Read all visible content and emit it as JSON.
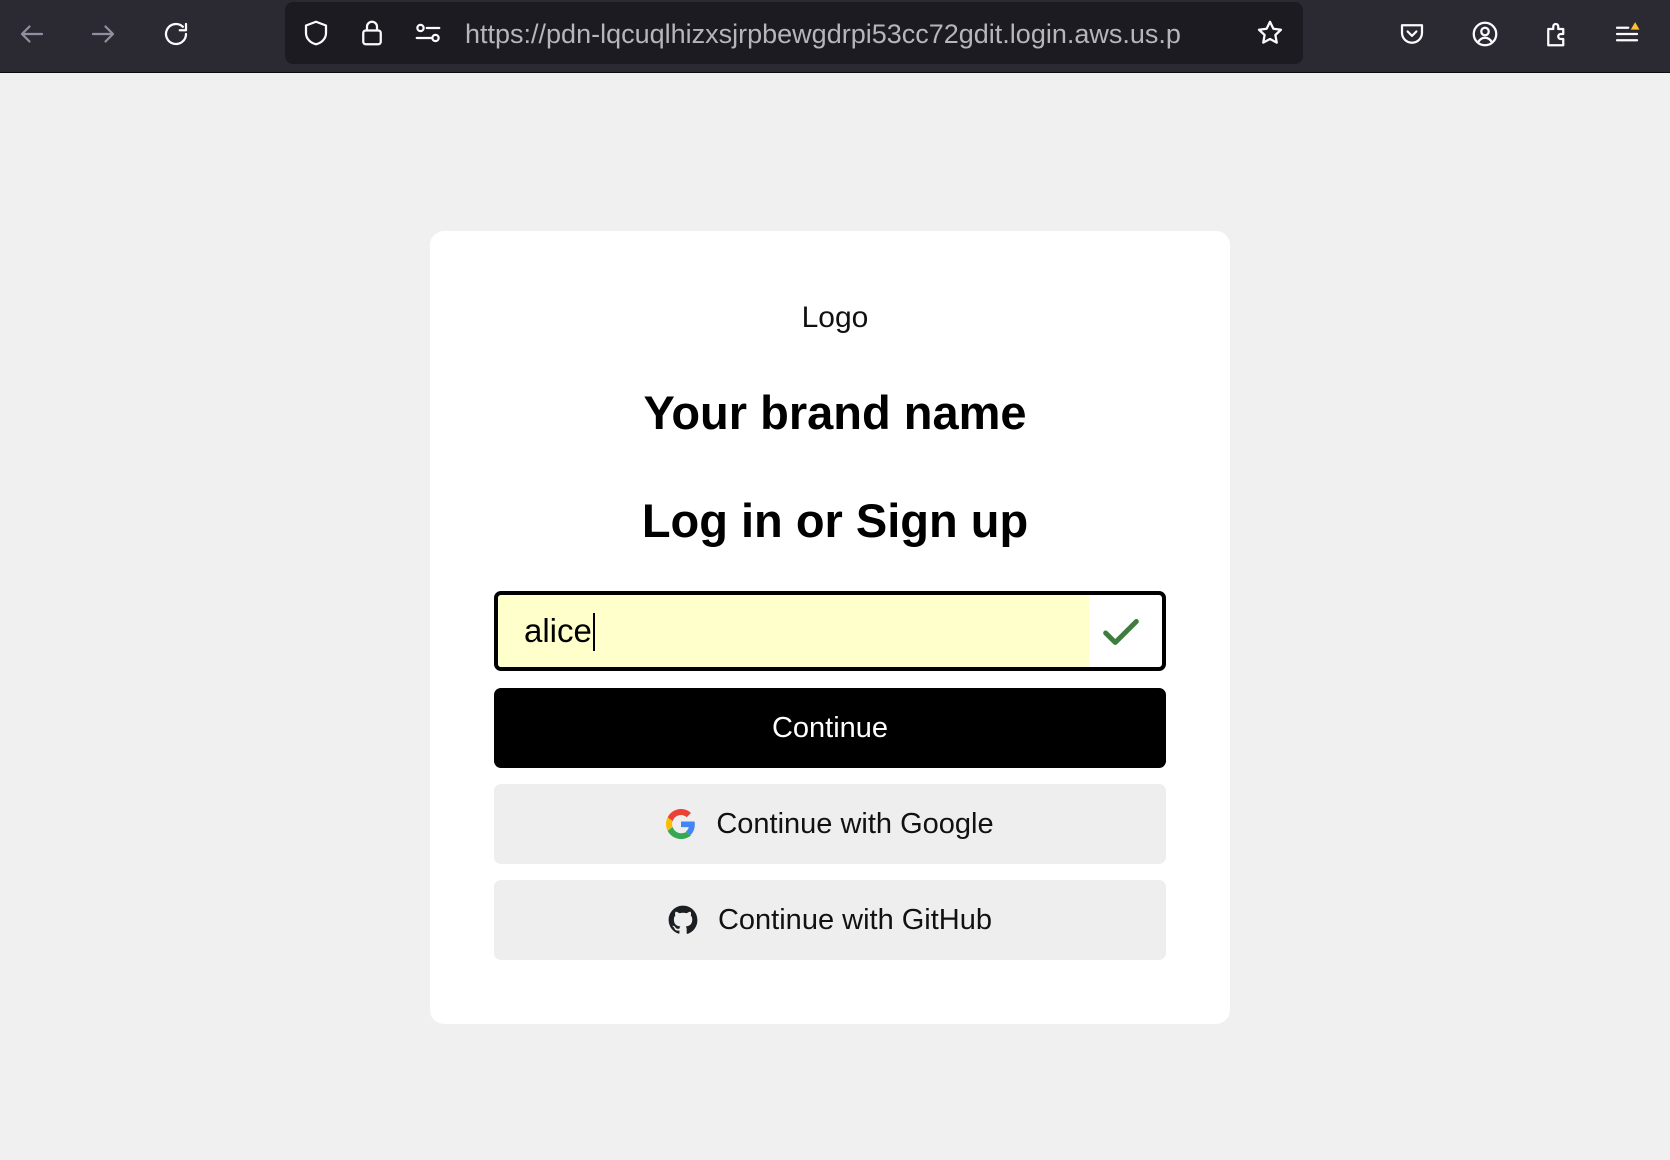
{
  "browser": {
    "url": "https://pdn-lqcuqlhizxsjrpbewgdrpi53cc72gdit.login.aws.us.p",
    "icons": {
      "back": "back-arrow-icon",
      "forward": "forward-arrow-icon",
      "reload": "reload-icon",
      "tracking": "shield-icon",
      "security": "lock-icon",
      "permissions": "permissions-icon",
      "bookmark": "star-icon",
      "pocket": "pocket-icon",
      "account": "account-icon",
      "extensions": "puzzle-icon",
      "menu": "menu-icon"
    }
  },
  "login": {
    "logo": "Logo",
    "brand_name": "Your brand name",
    "heading": "Log in or Sign up",
    "username_value": "alice",
    "continue_label": "Continue",
    "google_label": "Continue with Google",
    "github_label": "Continue with GitHub"
  },
  "colors": {
    "toolbar_bg": "#2b2a33",
    "urlbar_bg": "#1c1b22",
    "page_bg": "#f0f0f0",
    "autofill_bg": "#ffffcc",
    "check_green": "#3e7d3e",
    "primary_button": "#000000",
    "social_button": "#eeeeee",
    "menu_alert": "#ffbf2f"
  }
}
